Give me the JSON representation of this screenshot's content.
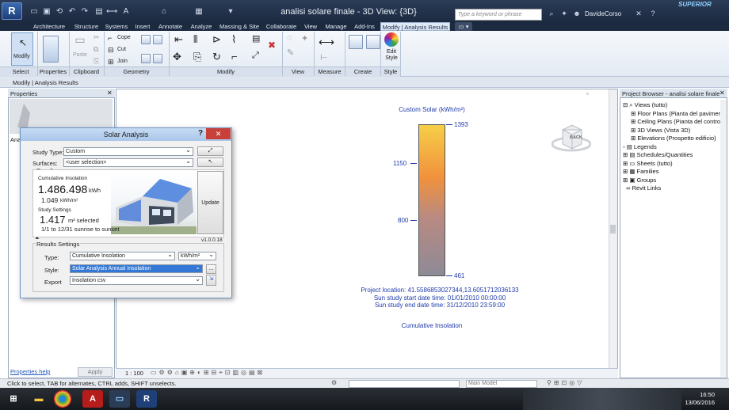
{
  "app": {
    "logo_text": "R",
    "window_title": "analisi solare finale - 3D View: {3D}",
    "search_placeholder": "Type a keyword or phrase",
    "user": "DavideCorso",
    "brand": "SUPERIOR"
  },
  "menu_tabs": [
    "Architecture",
    "Structure",
    "Systems",
    "Insert",
    "Annotate",
    "Analyze",
    "Massing & Site",
    "Collaborate",
    "View",
    "Manage",
    "Add-Ins",
    "Modify | Analysis Results"
  ],
  "ribbon": {
    "modify_label": "Modify",
    "paste_label": "Paste",
    "cope_label": "Cope",
    "cut_label": "Cut",
    "join_label": "Join",
    "edit_style_label": "Edit Style",
    "panels": [
      "Select",
      "Properties",
      "Clipboard",
      "Geometry",
      "Modify",
      "View",
      "Measure",
      "Create",
      "Style"
    ]
  },
  "context_strip": "Modify | Analysis Results",
  "properties": {
    "title": "Properties",
    "help_link": "Properties help",
    "apply_label": "Apply",
    "side_text": "Ana"
  },
  "view": {
    "scale": "1 : 100"
  },
  "legend": {
    "title": "Custom Solar  (kWh/m²)",
    "max": "1393",
    "t1150": "1150",
    "t800": "800",
    "min": "461",
    "project_location": "Project location: 41.5586853027344,13.6051712036133",
    "start": "Sun study start date time: 01/01/2010 00:00:00",
    "end": "Sun study end date time: 31/12/2010 23:59:00",
    "footer": "Cumulative Insolation"
  },
  "cube_label": "BACK",
  "browser": {
    "title": "Project Browser - analisi solare finale",
    "items": [
      "Views (tutto)",
      "Floor Plans (Pianta del pavimento)",
      "Ceiling Plans (Pianta del controsoffitto)",
      "3D Views (Vista 3D)",
      "Elevations (Prospetto edificio)",
      "Legends",
      "Schedules/Quantities",
      "Sheets (tutto)",
      "Families",
      "Groups",
      "Revit Links"
    ]
  },
  "status": {
    "text": "Click to select, TAB for alternates, CTRL adds, SHIFT unselects.",
    "workset": "Main Model"
  },
  "dialog": {
    "title": "Solar Analysis",
    "study_type_label": "Study Type:",
    "study_type_value": "Custom",
    "surfaces_label": "Surfaces:",
    "surfaces_value": "<user selection>",
    "results_label": "Results",
    "cumulative_label": "Cumulative Insolation",
    "cumulative_value": "1.486.498",
    "cumulative_unit": "kWh",
    "per_m2_value": "1.049",
    "per_m2_unit": "kWh/m²",
    "study_settings_label": "Study Settings",
    "area_value": "1.417",
    "area_unit": "m² selected",
    "date_range": "1/1 to 12/31 sunrise to sunset",
    "update_label": "Update",
    "version": "v1.0.0.18",
    "results_settings_label": "Results Settings",
    "type_label": "Type:",
    "type_value": "Cumulative Insolation",
    "unit_value": "kWh/m²",
    "style_label": "Style:",
    "style_value": "Solar Analysis Annual Insolation",
    "export_label": "Export",
    "export_value": "Insolation csv",
    "dots": "..."
  },
  "taskbar": {
    "time": "16:50",
    "date": "13/06/2016"
  }
}
